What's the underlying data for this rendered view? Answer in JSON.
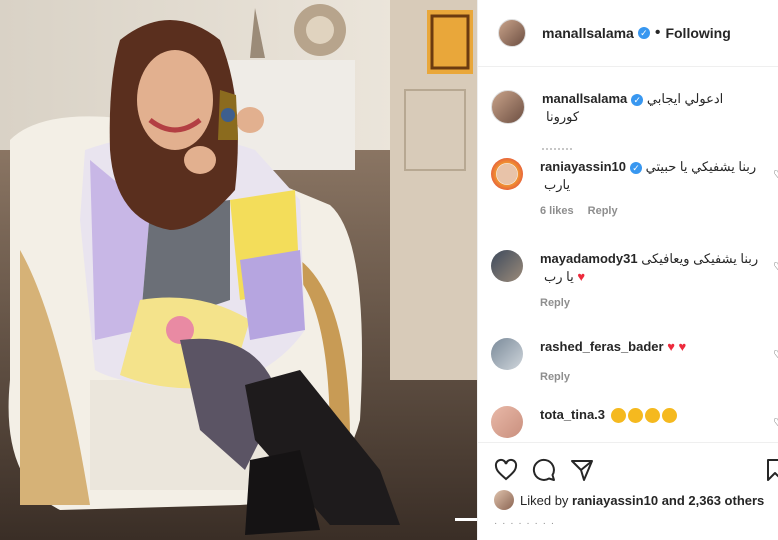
{
  "post": {
    "author": "manallsalama",
    "follow_state": "Following",
    "caption": "ادعولي ايجابي كورونا",
    "likes_text": "Liked by",
    "likes_user": "raniayassin10",
    "likes_rest": "and 2,363 others"
  },
  "comments": [
    {
      "user": "raniayassin10",
      "verified": true,
      "text": "ربنا يشفيكي يا حبيتي يارب",
      "likes": "6 likes",
      "reply": "Reply"
    },
    {
      "user": "mayadamody31",
      "verified": false,
      "text": "ربنا يشفيكى ويعافيكى يا رب",
      "reply": "Reply"
    },
    {
      "user": "rashed_feras_bader",
      "verified": false,
      "text": "",
      "reply": "Reply"
    },
    {
      "user": "tota_tina.3",
      "verified": false,
      "text": ""
    }
  ],
  "icons": {
    "like": "heart-icon",
    "comment": "comment-icon",
    "share": "paper-plane-icon",
    "save": "bookmark-icon",
    "verified": "verified-badge-icon"
  },
  "colors": {
    "accent": "#3897f0",
    "heart": "#ed2a3c",
    "muted": "#8e8e8e"
  }
}
